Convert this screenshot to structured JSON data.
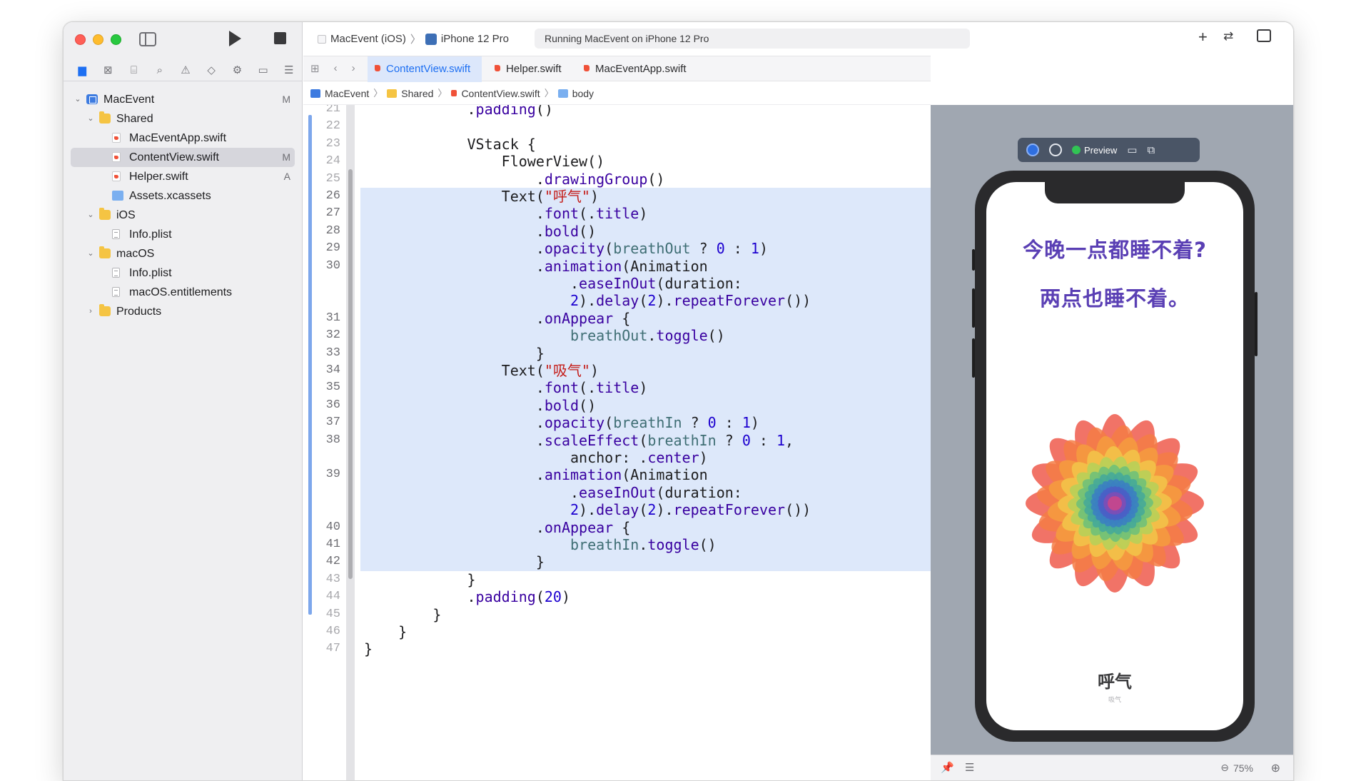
{
  "toolbar": {
    "scheme": "MacEvent (iOS)",
    "device": "iPhone 12 Pro",
    "status": "Running MacEvent on iPhone 12 Pro",
    "add_label": "+",
    "swap_label": "⇄",
    "inspector_label": "▯"
  },
  "navigator": {
    "icons": [
      "folder-icon",
      "source-control-icon",
      "symbol-icon",
      "search-icon",
      "issue-icon",
      "test-icon",
      "debug-icon",
      "breakpoint-icon",
      "report-icon"
    ],
    "tree": [
      {
        "label": "MacEvent",
        "badge": "M",
        "kind": "project",
        "depth": 0,
        "expanded": true
      },
      {
        "label": "Shared",
        "badge": "",
        "kind": "folder",
        "depth": 1,
        "expanded": true
      },
      {
        "label": "MacEventApp.swift",
        "badge": "",
        "kind": "swift",
        "depth": 2
      },
      {
        "label": "ContentView.swift",
        "badge": "M",
        "kind": "swift",
        "depth": 2,
        "selected": true
      },
      {
        "label": "Helper.swift",
        "badge": "A",
        "kind": "swift",
        "depth": 2
      },
      {
        "label": "Assets.xcassets",
        "badge": "",
        "kind": "assets",
        "depth": 2
      },
      {
        "label": "iOS",
        "badge": "",
        "kind": "folder",
        "depth": 1,
        "expanded": true
      },
      {
        "label": "Info.plist",
        "badge": "",
        "kind": "plist",
        "depth": 2
      },
      {
        "label": "macOS",
        "badge": "",
        "kind": "folder",
        "depth": 1,
        "expanded": true
      },
      {
        "label": "Info.plist",
        "badge": "",
        "kind": "plist",
        "depth": 2
      },
      {
        "label": "macOS.entitlements",
        "badge": "",
        "kind": "plist",
        "depth": 2
      },
      {
        "label": "Products",
        "badge": "",
        "kind": "folder",
        "depth": 1,
        "expanded": false
      }
    ]
  },
  "tabs": [
    {
      "label": "ContentView.swift",
      "active": true
    },
    {
      "label": "Helper.swift",
      "active": false
    },
    {
      "label": "MacEventApp.swift",
      "active": false
    }
  ],
  "breadcrumb": [
    "MacEvent",
    "Shared",
    "ContentView.swift",
    "body"
  ],
  "code": {
    "lines": [
      {
        "n": "21",
        "text": "            .padding()",
        "hl": false
      },
      {
        "n": "22",
        "text": "",
        "hl": false
      },
      {
        "n": "23",
        "text": "            VStack {",
        "hl": false
      },
      {
        "n": "24",
        "text": "                FlowerView()",
        "hl": false
      },
      {
        "n": "25",
        "text": "                    .drawingGroup()",
        "hl": false
      },
      {
        "n": "26",
        "text": "                Text(\"呼气\")",
        "hl": true
      },
      {
        "n": "27",
        "text": "                    .font(.title)",
        "hl": true
      },
      {
        "n": "28",
        "text": "                    .bold()",
        "hl": true
      },
      {
        "n": "29",
        "text": "                    .opacity(breathOut ? 0 : 1)",
        "hl": true
      },
      {
        "n": "30",
        "text": "                    .animation(Animation",
        "hl": true
      },
      {
        "n": "",
        "text": "                        .easeInOut(duration:",
        "hl": true
      },
      {
        "n": "",
        "text": "                        2).delay(2).repeatForever())",
        "hl": true
      },
      {
        "n": "31",
        "text": "                    .onAppear {",
        "hl": true
      },
      {
        "n": "32",
        "text": "                        breathOut.toggle()",
        "hl": true
      },
      {
        "n": "33",
        "text": "                    }",
        "hl": true
      },
      {
        "n": "34",
        "text": "                Text(\"吸气\")",
        "hl": true
      },
      {
        "n": "35",
        "text": "                    .font(.title)",
        "hl": true
      },
      {
        "n": "36",
        "text": "                    .bold()",
        "hl": true
      },
      {
        "n": "37",
        "text": "                    .opacity(breathIn ? 0 : 1)",
        "hl": true
      },
      {
        "n": "38",
        "text": "                    .scaleEffect(breathIn ? 0 : 1,",
        "hl": true
      },
      {
        "n": "",
        "text": "                        anchor: .center)",
        "hl": true
      },
      {
        "n": "39",
        "text": "                    .animation(Animation",
        "hl": true
      },
      {
        "n": "",
        "text": "                        .easeInOut(duration:",
        "hl": true
      },
      {
        "n": "",
        "text": "                        2).delay(2).repeatForever())",
        "hl": true
      },
      {
        "n": "40",
        "text": "                    .onAppear {",
        "hl": true
      },
      {
        "n": "41",
        "text": "                        breathIn.toggle()",
        "hl": true
      },
      {
        "n": "42",
        "text": "                    }",
        "hl": true
      },
      {
        "n": "43",
        "text": "            }",
        "hl": false
      },
      {
        "n": "44",
        "text": "            .padding(20)",
        "hl": false
      },
      {
        "n": "45",
        "text": "        }",
        "hl": false
      },
      {
        "n": "46",
        "text": "    }",
        "hl": false
      },
      {
        "n": "47",
        "text": "}",
        "hl": false
      }
    ]
  },
  "preview": {
    "label": "Preview",
    "line1": "今晚一点都睡不着?",
    "line2": "两点也睡不着。",
    "breath_label": "呼气",
    "breath_small": "吸气",
    "zoom": "75%"
  },
  "colors": {
    "accent": "#1d6ff2",
    "highlight": "#dde8fa",
    "preview_title": "#5a3fb4"
  }
}
